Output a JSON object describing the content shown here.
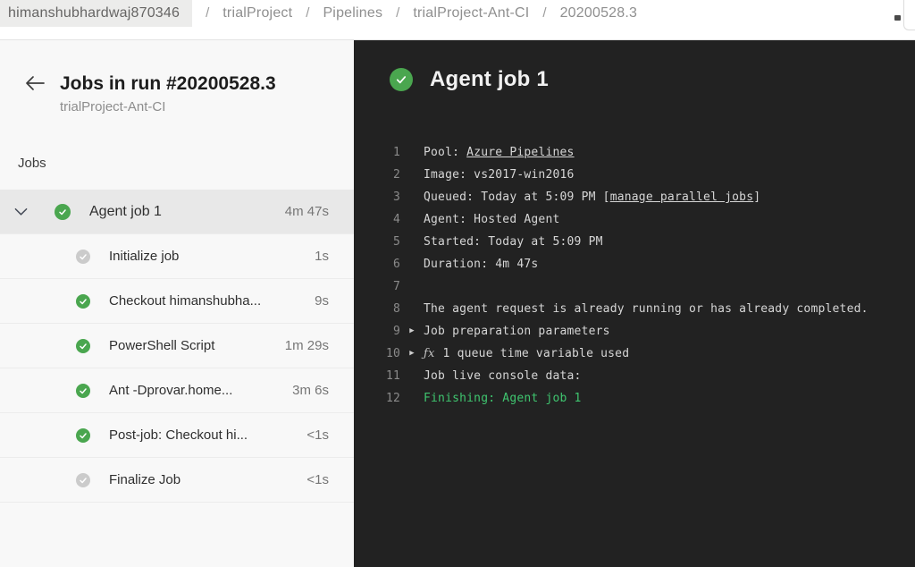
{
  "breadcrumb": {
    "separator": "/",
    "items": [
      {
        "label": "himanshubhardwaj870346",
        "chip": true
      },
      {
        "label": "trialProject",
        "chip": false
      },
      {
        "label": "Pipelines",
        "chip": false
      },
      {
        "label": "trialProject-Ant-CI",
        "chip": false
      },
      {
        "label": "20200528.3",
        "chip": false
      }
    ]
  },
  "panel": {
    "title": "Jobs in run #20200528.3",
    "subtitle": "trialProject-Ant-CI",
    "section_label": "Jobs",
    "jobs": [
      {
        "label": "Agent job 1",
        "duration": "4m 47s",
        "status": "success",
        "level": "job",
        "expanded": true,
        "selected": true
      },
      {
        "label": "Initialize job",
        "duration": "1s",
        "status": "neutral",
        "level": "step"
      },
      {
        "label": "Checkout himanshubha...",
        "duration": "9s",
        "status": "success",
        "level": "step"
      },
      {
        "label": "PowerShell Script",
        "duration": "1m 29s",
        "status": "success",
        "level": "step"
      },
      {
        "label": "Ant -Dprovar.home...",
        "duration": "3m 6s",
        "status": "success",
        "level": "step"
      },
      {
        "label": "Post-job: Checkout hi...",
        "duration": "<1s",
        "status": "success",
        "level": "step"
      },
      {
        "label": "Finalize Job",
        "duration": "<1s",
        "status": "neutral",
        "level": "step"
      }
    ]
  },
  "console": {
    "title": "Agent job 1",
    "status": "success",
    "expander_icon": "▶",
    "fx_icon": "ƒx",
    "log_lines": [
      {
        "num": "1",
        "segments": [
          {
            "text": "Pool: ",
            "type": "text"
          },
          {
            "text": "Azure Pipelines",
            "type": "link"
          }
        ]
      },
      {
        "num": "2",
        "segments": [
          {
            "text": "Image: vs2017-win2016",
            "type": "text"
          }
        ]
      },
      {
        "num": "3",
        "segments": [
          {
            "text": "Queued: Today at 5:09 PM [",
            "type": "text"
          },
          {
            "text": "manage parallel jobs",
            "type": "link"
          },
          {
            "text": "]",
            "type": "text"
          }
        ]
      },
      {
        "num": "4",
        "segments": [
          {
            "text": "Agent: Hosted Agent",
            "type": "text"
          }
        ]
      },
      {
        "num": "5",
        "segments": [
          {
            "text": "Started: Today at 5:09 PM",
            "type": "text"
          }
        ]
      },
      {
        "num": "6",
        "segments": [
          {
            "text": "Duration: 4m 47s",
            "type": "text"
          }
        ]
      },
      {
        "num": "7",
        "segments": []
      },
      {
        "num": "8",
        "segments": [
          {
            "text": "The agent request is already running or has already completed.",
            "type": "text"
          }
        ]
      },
      {
        "num": "9",
        "expander": true,
        "segments": [
          {
            "text": "Job preparation parameters",
            "type": "text"
          }
        ]
      },
      {
        "num": "10",
        "expander": true,
        "fx": true,
        "segments": [
          {
            "text": "1 queue time variable used",
            "type": "text"
          }
        ]
      },
      {
        "num": "11",
        "segments": [
          {
            "text": "Job live console data:",
            "type": "text"
          }
        ]
      },
      {
        "num": "12",
        "segments": [
          {
            "text": "Finishing: Agent job 1",
            "type": "success"
          }
        ]
      }
    ]
  },
  "colors": {
    "success_green": "#4aa64f",
    "log_success_green": "#3fc56f",
    "console_bg": "#222222",
    "selected_row_bg": "#e8e8e8"
  }
}
